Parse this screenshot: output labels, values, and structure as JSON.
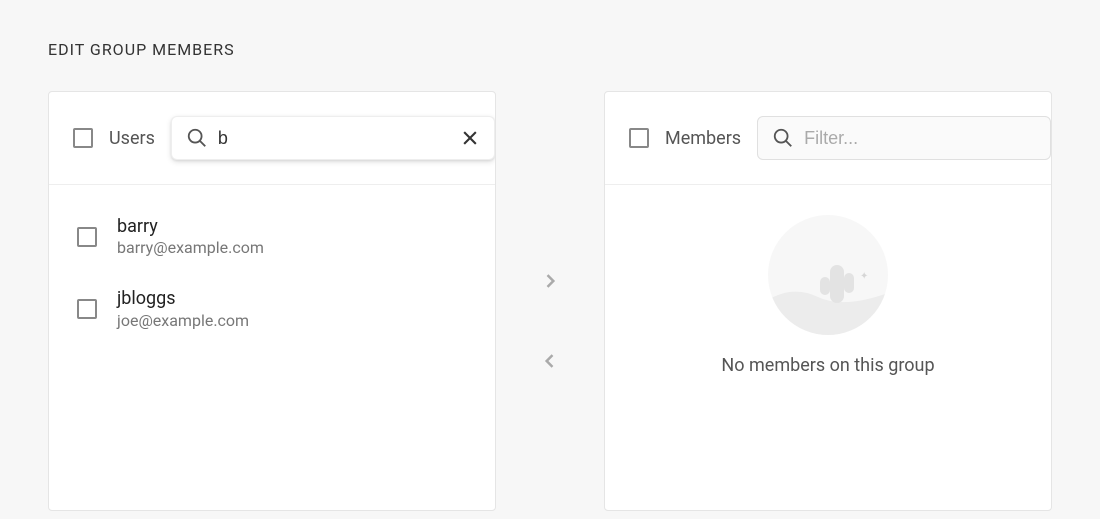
{
  "title": "EDIT GROUP MEMBERS",
  "users_panel": {
    "label": "Users",
    "search_value": "b",
    "search_placeholder": "Filter...",
    "items": [
      {
        "name": "barry",
        "email": "barry@example.com"
      },
      {
        "name": "jbloggs",
        "email": "joe@example.com"
      }
    ]
  },
  "members_panel": {
    "label": "Members",
    "search_value": "",
    "search_placeholder": "Filter...",
    "empty_text": "No members on this group"
  }
}
